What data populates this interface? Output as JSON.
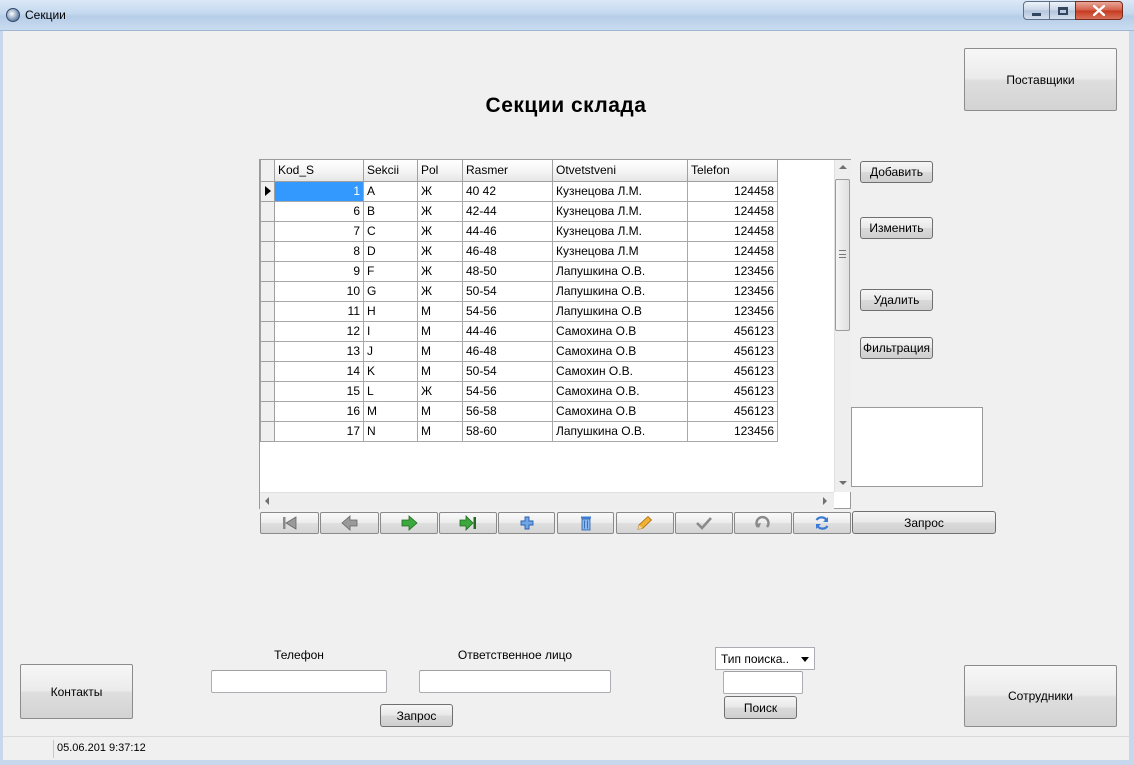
{
  "window": {
    "title": "Секции"
  },
  "page_title": "Секции склада",
  "buttons": {
    "suppliers": "Поставщики",
    "add": "Добавить",
    "edit": "Изменить",
    "delete": "Удалить",
    "filter": "Фильтрация",
    "query_nav": "Запрос",
    "contacts": "Контакты",
    "query_bottom": "Запрос",
    "search": "Поиск",
    "employees": "Сотрудники"
  },
  "table": {
    "columns": [
      "Kod_S",
      "Sekcii",
      "Pol",
      "Rasmer",
      "Otvetstveni",
      "Telefon"
    ],
    "rows": [
      [
        "1",
        "A",
        "Ж",
        "40 42",
        "Кузнецова Л.М.",
        "124458"
      ],
      [
        "6",
        "B",
        "Ж",
        "42-44",
        "Кузнецова Л.М.",
        "124458"
      ],
      [
        "7",
        "C",
        "Ж",
        "44-46",
        "Кузнецова Л.М.",
        "124458"
      ],
      [
        "8",
        "D",
        "Ж",
        "46-48",
        "Кузнецова Л.М",
        "124458"
      ],
      [
        "9",
        "F",
        "Ж",
        "48-50",
        "Лапушкина О.В.",
        "123456"
      ],
      [
        "10",
        "G",
        "Ж",
        "50-54",
        "Лапушкина О.В.",
        "123456"
      ],
      [
        "11",
        "H",
        "М",
        "54-56",
        "Лапушкина О.В",
        "123456"
      ],
      [
        "12",
        "I",
        "М",
        "44-46",
        "Самохина О.В",
        "456123"
      ],
      [
        "13",
        "J",
        "М",
        "46-48",
        "Самохина О.В",
        "456123"
      ],
      [
        "14",
        "K",
        "М",
        "50-54",
        "Самохин О.В.",
        "456123"
      ],
      [
        "15",
        "L",
        "Ж",
        "54-56",
        "Самохина О.В.",
        "456123"
      ],
      [
        "16",
        "M",
        "М",
        "56-58",
        "Самохина О.В",
        "456123"
      ],
      [
        "17",
        "N",
        "М",
        "58-60",
        "Лапушкина О.В.",
        "123456"
      ]
    ],
    "selected_row": 0
  },
  "navigator": {
    "icons": [
      "first-record-icon",
      "prior-record-icon",
      "next-record-icon",
      "last-record-icon",
      "insert-record-icon",
      "delete-record-icon",
      "edit-record-icon",
      "post-record-icon",
      "cancel-record-icon",
      "refresh-icon"
    ],
    "colors": {
      "green": "#3aa83a",
      "blue": "#3a7bd5",
      "gray": "#8a8a8a",
      "pencil": "#e0a020"
    }
  },
  "filters": {
    "phone_label": "Телефон",
    "phone_value": "",
    "responsible_label": "Ответственное лицо",
    "responsible_value": "",
    "search_type": "Тип поиска..",
    "search_value": ""
  },
  "status": {
    "text": "05.06.201 9:37:12"
  },
  "colors": {
    "selection": "#3399ff",
    "window_bg": "#f0f0f0",
    "titlebar": "#c4d8ee"
  }
}
